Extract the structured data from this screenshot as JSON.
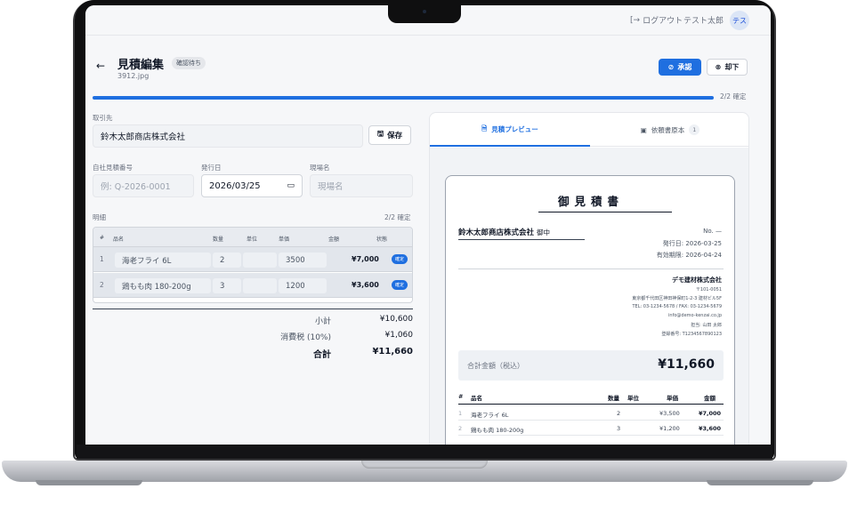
{
  "topbar": {
    "logout_label": "ログアウト",
    "user_name": "テスト太郎",
    "avatar_text": "テス"
  },
  "header": {
    "title": "見積編集",
    "status_badge": "確認待ち",
    "filename": "3912.jpg",
    "approve_label": "承認",
    "reject_label": "却下",
    "progress_label": "2/2 確定"
  },
  "form": {
    "client_label": "取引先",
    "client_value": "鈴木太郎商店株式会社",
    "save_label": "保存",
    "quote_no_label": "自社見積番号",
    "quote_no_placeholder": "例: Q-2026-0001",
    "issue_date_label": "発行日",
    "issue_date_value": "2026/03/25",
    "site_label": "現場名",
    "site_placeholder": "現場名",
    "items_label": "明細",
    "items_progress": "2/2 確定",
    "columns": [
      "#",
      "品名",
      "数量",
      "単位",
      "単価",
      "金額",
      "状態"
    ],
    "rows": [
      {
        "no": "1",
        "name": "海老フライ 6L",
        "qty": "2",
        "unit": "",
        "price": "3500",
        "amount": "¥7,000",
        "status": "確定"
      },
      {
        "no": "2",
        "name": "鶏もも肉 180-200g",
        "qty": "3",
        "unit": "",
        "price": "1200",
        "amount": "¥3,600",
        "status": "確定"
      }
    ],
    "subtotal_label": "小計",
    "subtotal_value": "¥10,600",
    "tax_label": "消費税 (10%)",
    "tax_value": "¥1,060",
    "total_label": "合計",
    "total_value": "¥11,660"
  },
  "preview": {
    "tab_preview": "見積プレビュー",
    "tab_original": "依頼書原本",
    "tab_original_count": "1",
    "doc_title": "御見積書",
    "client_name": "鈴木太郎商店株式会社",
    "client_honorific": "御中",
    "doc_no": "No. —",
    "issue_date": "発行日: 2026-03-25",
    "valid_until": "有効期限: 2026-04-24",
    "company": "デモ建材株式会社",
    "addr_lines": [
      "〒101-0051",
      "東京都千代田区神田神保町1-2-3 建材ビル5F",
      "TEL: 03-1234-5678 / FAX: 03-1234-5679",
      "info@demo-kenzai.co.jp",
      "担当: 山田 太郎",
      "登録番号: T1234567890123"
    ],
    "total_label": "合計金額（税込）",
    "total_value": "¥11,660",
    "columns": [
      "#",
      "品名",
      "数量",
      "単位",
      "単価",
      "金額"
    ],
    "rows": [
      {
        "no": "1",
        "name": "海老フライ 6L",
        "qty": "2",
        "price": "¥3,500",
        "amount": "¥7,000"
      },
      {
        "no": "2",
        "name": "鶏もも肉 180-200g",
        "qty": "3",
        "price": "¥1,200",
        "amount": "¥3,600"
      }
    ]
  },
  "icons": {
    "back": "arrow-left-icon",
    "logout": "logout-icon",
    "approve": "check-circle-icon",
    "reject": "x-circle-icon",
    "save": "save-icon",
    "calendar": "calendar-icon",
    "document": "document-icon",
    "image": "image-icon"
  },
  "colors": {
    "accent": "#1f6fe0",
    "background": "#f6f7f9"
  }
}
